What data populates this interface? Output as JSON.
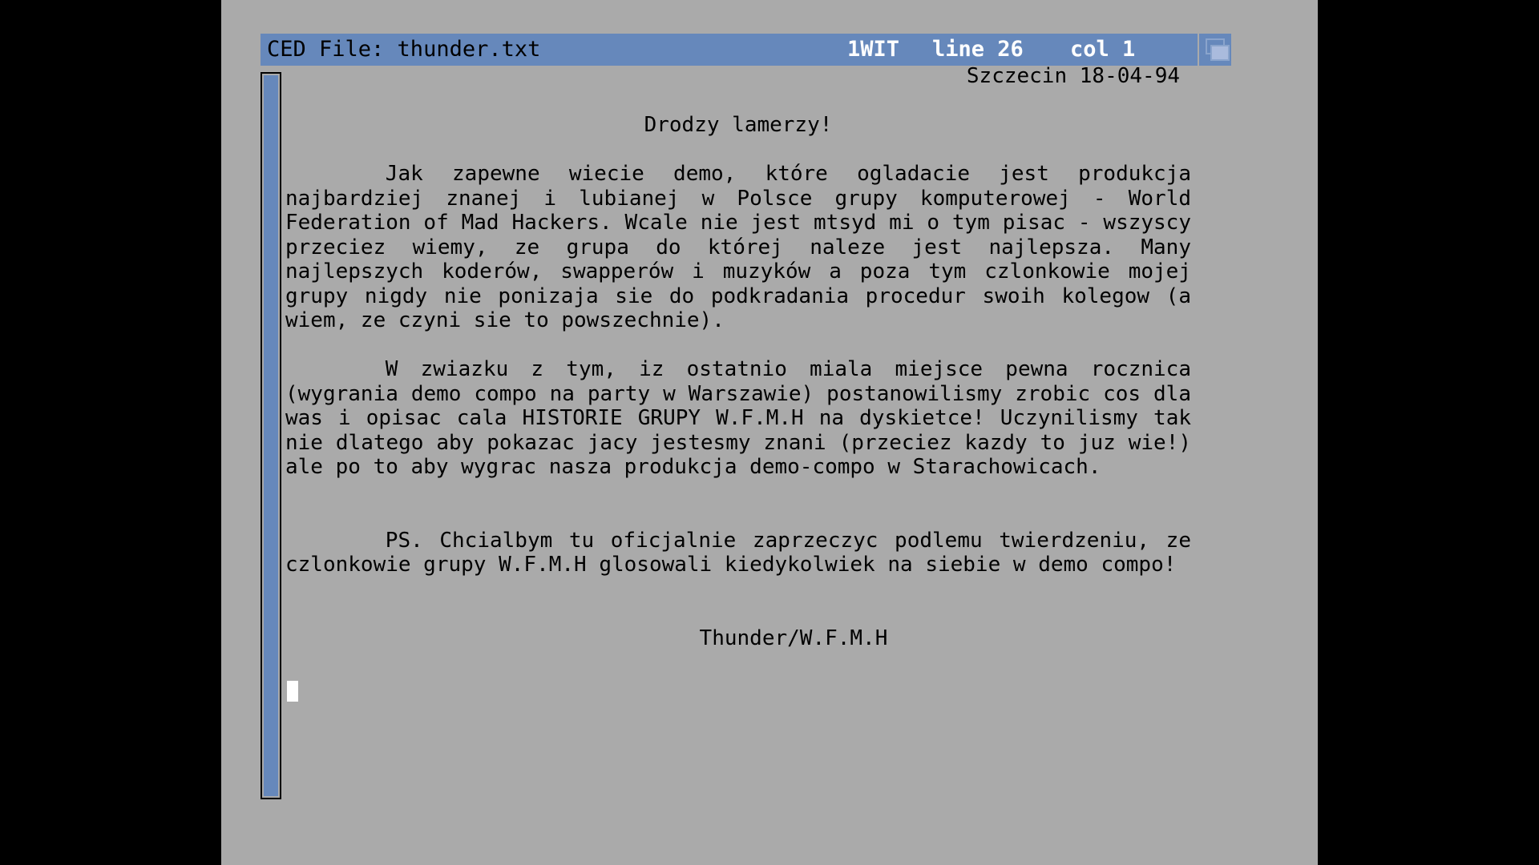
{
  "titlebar": {
    "filename": "CED File: thunder.txt",
    "mode": "1WIT",
    "line": "line 26",
    "col": "col 1"
  },
  "document": {
    "lines": [
      {
        "text": "Szczecin 18-04-94",
        "align": "right"
      },
      {
        "text": "",
        "align": "left"
      },
      {
        "text": "Drodzy lamerzy!",
        "align": "center"
      },
      {
        "text": "",
        "align": "left"
      },
      {
        "text": "        Jak  zapewne  wiecie  demo,  które  ogladacie  jest  produkcja",
        "align": "justify"
      },
      {
        "text": "najbardziej  znanej  i  lubianej  w  Polsce  grupy  komputerowej  -  World",
        "align": "justify"
      },
      {
        "text": "Federation  of Mad Hackers.  Wcale nie jest mtsyd mi o tym pisac - wszyscy",
        "align": "justify"
      },
      {
        "text": "przeciez  wiemy,  ze  grupa  do  której  naleze  jest  najlepsza.  Many",
        "align": "justify"
      },
      {
        "text": "najlepszych  koderów,  swapperów  i  muzyków  a poza tym czlonkowie mojej",
        "align": "justify"
      },
      {
        "text": "grupy  nigdy  nie  ponizaja  sie  do podkradania procedur swoih kolegow (a",
        "align": "justify"
      },
      {
        "text": "wiem, ze czyni sie to powszechnie).",
        "align": "left"
      },
      {
        "text": "",
        "align": "left"
      },
      {
        "text": "        W  zwiazku  z  tym,  iz  ostatnio  miala  miejsce  pewna  rocznica",
        "align": "justify"
      },
      {
        "text": "(wygrania  demo  compo na party w Warszawie) postanowilismy zrobic cos dla",
        "align": "justify"
      },
      {
        "text": "was  i  opisac  cala HISTORIE GRUPY W.F.M.H na dyskietce!  Uczynilismy tak",
        "align": "justify"
      },
      {
        "text": "nie  dlatego  aby pokazac jacy jestesmy znani (przeciez kazdy to juz wie!)",
        "align": "justify"
      },
      {
        "text": "ale po to aby wygrac nasza produkcja demo-compo w Starachowicach.",
        "align": "left"
      },
      {
        "text": "",
        "align": "left"
      },
      {
        "text": "",
        "align": "left"
      },
      {
        "text": "        PS.  Chcialbym  tu  oficjalnie zaprzeczyc podlemu twierdzeniu, ze",
        "align": "justify"
      },
      {
        "text": "czlonkowie grupy W.F.M.H glosowali kiedykolwiek na siebie w demo compo!",
        "align": "left"
      },
      {
        "text": "",
        "align": "left"
      },
      {
        "text": "",
        "align": "left"
      },
      {
        "text": "                                 Thunder/W.F.M.H",
        "align": "left"
      }
    ]
  },
  "colors": {
    "screen_bg": "#aaaaaa",
    "titlebar_bg": "#6688bb",
    "text": "#000000",
    "cursor": "#ffffff"
  }
}
